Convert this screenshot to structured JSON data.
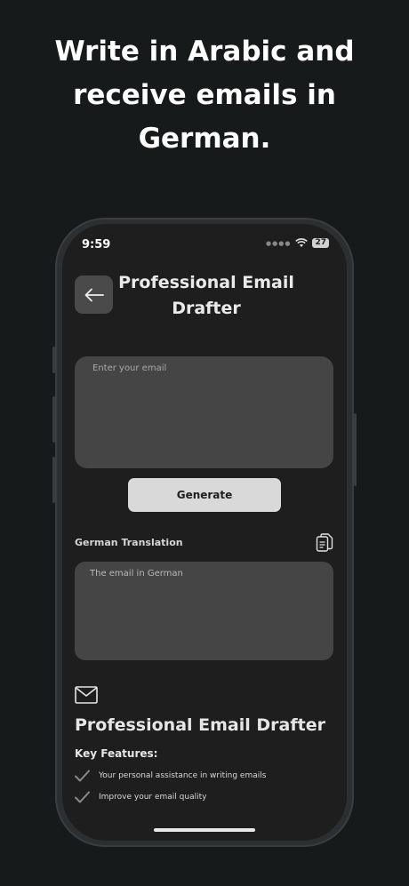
{
  "promo": {
    "line1": "Write in Arabic and",
    "line2": "receive emails in",
    "line3": "German."
  },
  "status_bar": {
    "time": "9:59",
    "battery": "27"
  },
  "header": {
    "back_icon": "arrow-left-icon",
    "title": "Professional Email Drafter"
  },
  "email_input": {
    "placeholder": "Enter your email",
    "value": ""
  },
  "generate_button": {
    "label": "Generate"
  },
  "translation": {
    "label": "German Translation",
    "copy_icon": "copy-icon",
    "placeholder": "The email in German"
  },
  "about": {
    "icon": "mail-icon",
    "app_name": "Professional Email Drafter",
    "features_title": "Key Features:",
    "features": [
      {
        "icon": "check-icon",
        "text": "Your personal assistance in writing emails"
      },
      {
        "icon": "check-icon",
        "text": "Improve your email quality"
      }
    ]
  }
}
